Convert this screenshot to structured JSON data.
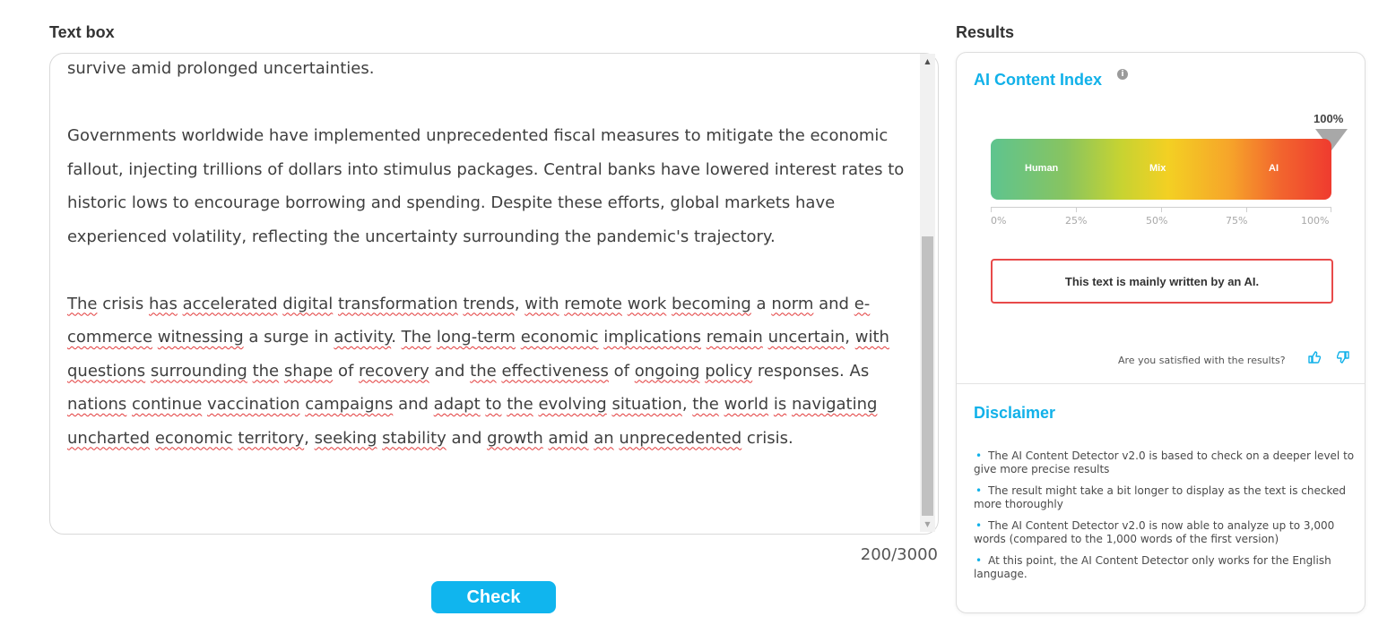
{
  "labels": {
    "text_box": "Text box",
    "results": "Results"
  },
  "textbox": {
    "paragraphs": [
      "survive amid prolonged uncertainties.",
      "Governments worldwide have implemented unprecedented fiscal measures to mitigate the economic fallout, injecting trillions of dollars into stimulus packages. Central banks have lowered interest rates to historic lows to encourage borrowing and spending. Despite these efforts, global markets have experienced volatility, reflecting the uncertainty surrounding the pandemic's trajectory.",
      "The crisis has accelerated digital transformation trends, with remote work becoming a norm and e-commerce witnessing a surge in activity. The long-term economic implications remain uncertain, with questions surrounding the shape of recovery and the effectiveness of ongoing policy responses. As nations continue vaccination campaigns and adapt to the evolving situation, the world is navigating uncharted economic territory, seeking stability and growth amid an unprecedented crisis."
    ],
    "word_count": "200/3000"
  },
  "check_button": "Check",
  "results": {
    "index_title": "AI Content Index",
    "info_icon": "i",
    "top_percent": "100%",
    "score_percent": 100,
    "gauge_labels": [
      "Human",
      "Mix",
      "AI"
    ],
    "ticks": [
      "0%",
      "25%",
      "50%",
      "75%",
      "100%"
    ],
    "verdict": "This text is mainly written by an AI.",
    "satisfied_question": "Are you satisfied with the results?",
    "icons": {
      "thumb_up": "thumb-up-icon",
      "thumb_down": "thumb-down-icon"
    }
  },
  "disclaimer": {
    "title": "Disclaimer",
    "items": [
      "The AI Content Detector v2.0 is based to check on a deeper level to give more precise results",
      "The result might take a bit longer to display as the text is checked more thoroughly",
      "The AI Content Detector v2.0 is now able to analyze up to 3,000 words (compared to the 1,000 words of the first version)",
      "At this point, the AI Content Detector only works for the English language."
    ]
  },
  "colors": {
    "accent": "#10b5ee",
    "verdict_border": "#e84a4a",
    "gauge_start": "#5ec48f",
    "gauge_mid": "#f3d023",
    "gauge_end": "#ef3b2f"
  }
}
